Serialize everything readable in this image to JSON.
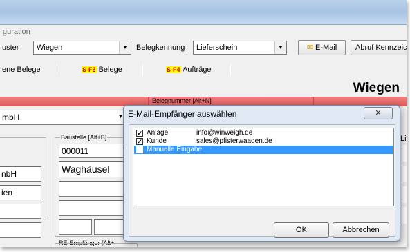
{
  "menubar": {
    "item": "guration"
  },
  "toolbar": {
    "muster_label": "uster",
    "muster_value": "Wiegen",
    "belegkennung_label": "Belegkennung",
    "belegkennung_value": "Lieferschein",
    "email_button": "E-Mail",
    "abruf_button": "Abruf Kennzeic"
  },
  "tabs": [
    {
      "label": "ene Belege"
    },
    {
      "key": "S-F3",
      "label": "Belege"
    },
    {
      "key": "S-F4",
      "label": "Aufträge"
    }
  ],
  "page_title": "Wiegen",
  "form": {
    "company_combo": "mbH",
    "belegnummer_label": "Belegnummer [Alt+N]",
    "baustelle_label": "Baustelle [Alt+B]",
    "baustelle_nr": "000011",
    "baustelle_ort": "Waghäusel",
    "left_field_1": "nbH",
    "left_field_2": "ien",
    "re_empfaenger_label": "RE-Empfänger [Alt+",
    "right_label": "Li"
  },
  "dialog": {
    "title": "E-Mail-Empfänger auswählen",
    "close_label": "✕",
    "items": [
      {
        "name": "Anlage",
        "email": "info@winweigh.de",
        "checked": "✔"
      },
      {
        "name": "Kunde",
        "email": "sales@pfisterwaagen.de",
        "checked": "✔"
      },
      {
        "name": "Manuelle Eingabe",
        "email": "",
        "checked": ""
      }
    ],
    "ok_button": "OK",
    "cancel_button": "Abbrechen"
  },
  "colors": {
    "selection": "#3399ff",
    "band": "#e05a5a",
    "hotkey_bg": "#ffff00"
  }
}
